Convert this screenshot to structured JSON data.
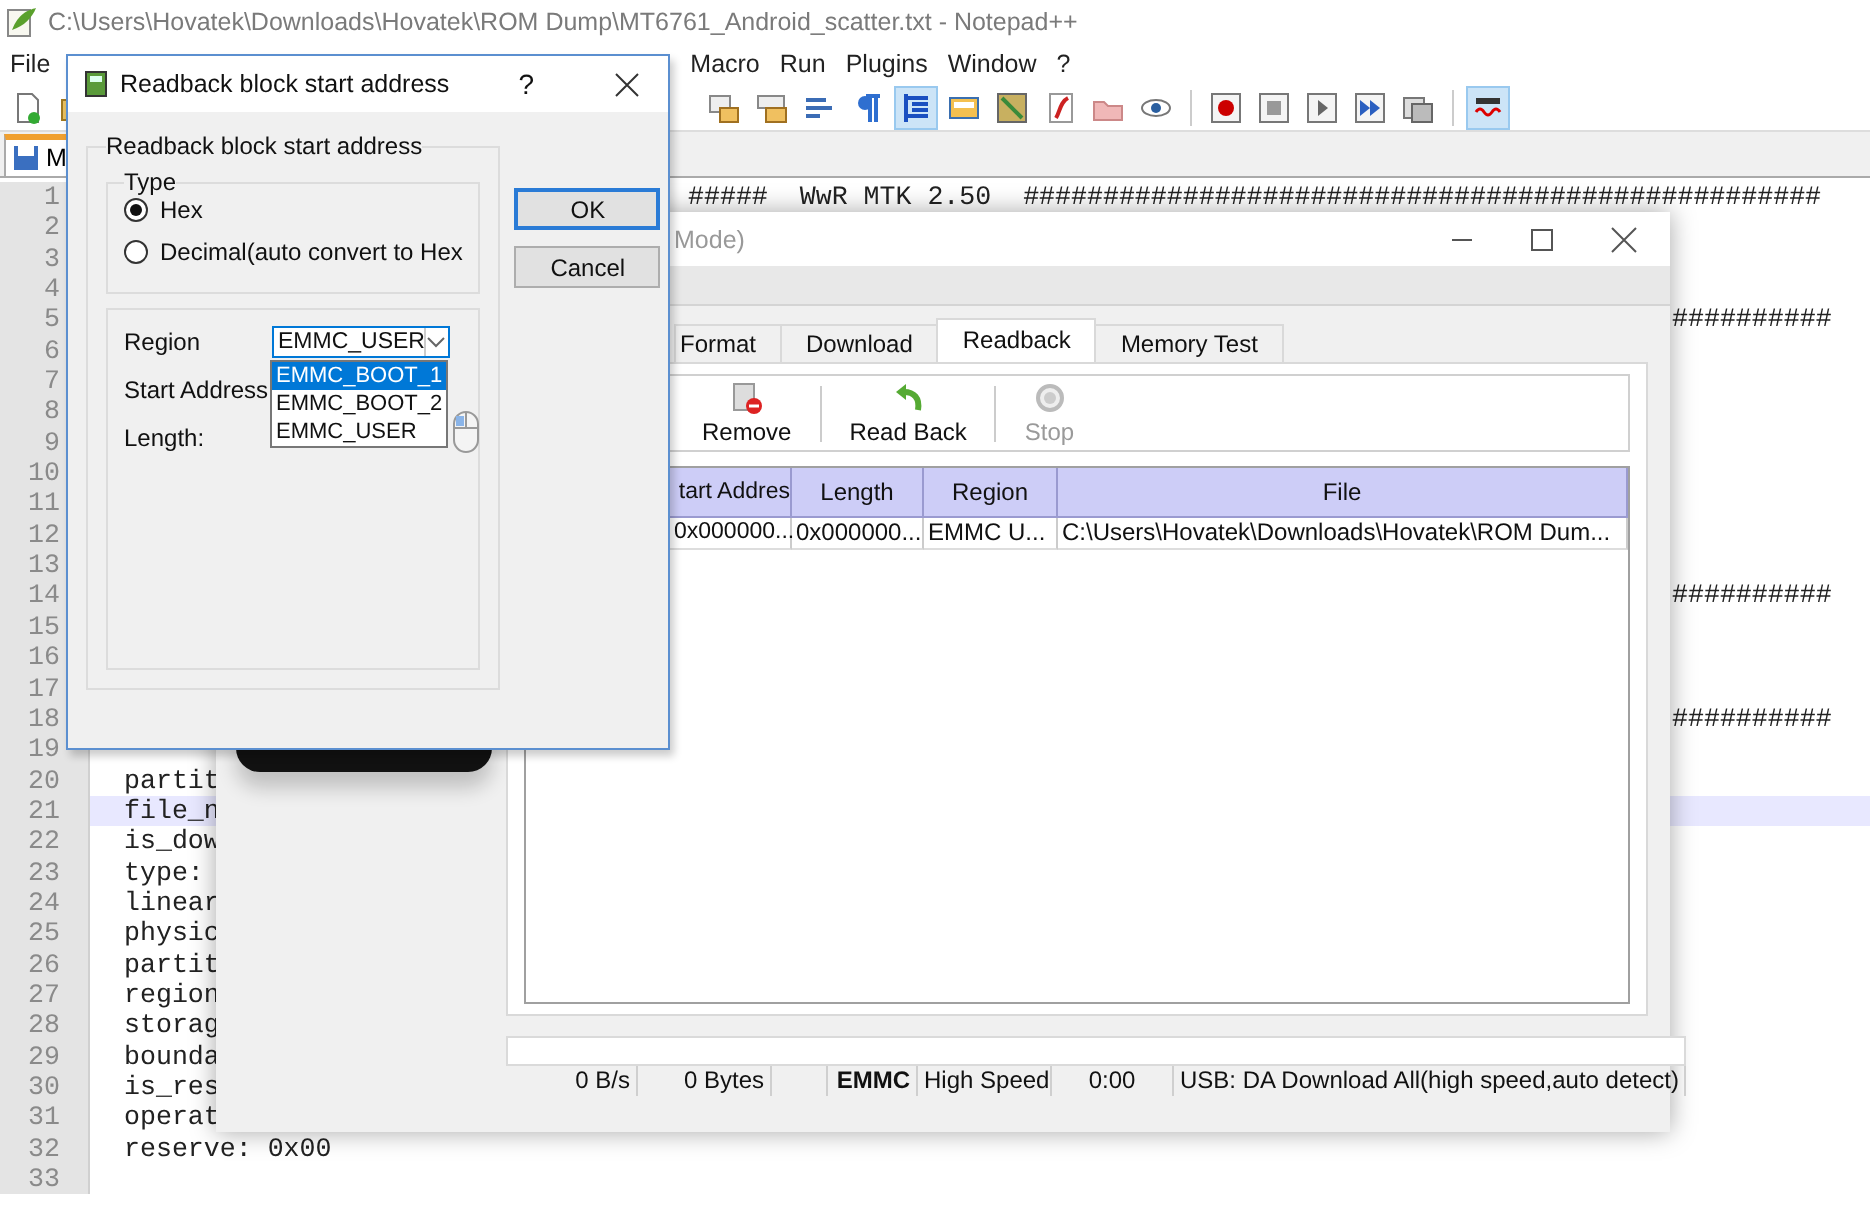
{
  "notepad": {
    "title": "C:\\Users\\Hovatek\\Downloads\\Hovatek\\ROM Dump\\MT6761_Android_scatter.txt - Notepad++",
    "menu": [
      {
        "label": "File"
      },
      {
        "label": "Macro"
      },
      {
        "label": "Run"
      },
      {
        "label": "Plugins"
      },
      {
        "label": "Window"
      },
      {
        "label": "?"
      }
    ],
    "toolbar": [
      {
        "kind": "new",
        "on": false
      },
      {
        "kind": "open",
        "on": false
      },
      {
        "kind": "sync-v",
        "on": false
      },
      {
        "kind": "sync-h",
        "on": false
      },
      {
        "kind": "wrap",
        "on": false
      },
      {
        "kind": "pilcrow",
        "on": false
      },
      {
        "kind": "indent",
        "on": true
      },
      {
        "kind": "panel",
        "on": false
      },
      {
        "kind": "map",
        "on": false
      },
      {
        "kind": "function",
        "on": false
      },
      {
        "kind": "folder",
        "on": false
      },
      {
        "kind": "eye",
        "on": false
      },
      {
        "kind": "record",
        "on": false
      },
      {
        "kind": "stop",
        "on": false
      },
      {
        "kind": "play",
        "on": false
      },
      {
        "kind": "run",
        "on": false
      },
      {
        "kind": "save",
        "on": false
      },
      {
        "kind": "spell",
        "on": true
      }
    ],
    "tab": {
      "label": "M"
    },
    "lines": [
      {
        "number": "1",
        "segments": [
          {
            "kind": "middle",
            "text": "#####  WwR MTK 2.50  ##################################################"
          }
        ]
      },
      {
        "number": "2"
      },
      {
        "number": "3"
      },
      {
        "number": "4"
      },
      {
        "number": "5",
        "segments": [
          {
            "kind": "end",
            "text": "##########"
          }
        ]
      },
      {
        "number": "6"
      },
      {
        "number": "7"
      },
      {
        "number": "8"
      },
      {
        "number": "9"
      },
      {
        "number": "10"
      },
      {
        "number": "11"
      },
      {
        "number": "12"
      },
      {
        "number": "13"
      },
      {
        "number": "14",
        "segments": [
          {
            "kind": "end",
            "text": "##########"
          }
        ]
      },
      {
        "number": "15"
      },
      {
        "number": "16"
      },
      {
        "number": "17"
      },
      {
        "number": "18",
        "segments": [
          {
            "kind": "end",
            "text": "##########"
          }
        ]
      },
      {
        "number": "19"
      },
      {
        "number": "20",
        "segments": [
          {
            "kind": "start",
            "text": "partit"
          }
        ]
      },
      {
        "number": "21",
        "highlighted": true,
        "segments": [
          {
            "kind": "start",
            "text": "file_n"
          }
        ]
      },
      {
        "number": "22",
        "segments": [
          {
            "kind": "start",
            "text": "is_dow"
          }
        ]
      },
      {
        "number": "23",
        "segments": [
          {
            "kind": "start",
            "text": "type:"
          }
        ]
      },
      {
        "number": "24",
        "segments": [
          {
            "kind": "start",
            "text": "linear"
          }
        ]
      },
      {
        "number": "25",
        "segments": [
          {
            "kind": "start",
            "text": "physic"
          }
        ]
      },
      {
        "number": "26",
        "segments": [
          {
            "kind": "start",
            "text": "partit"
          }
        ]
      },
      {
        "number": "27",
        "segments": [
          {
            "kind": "start",
            "text": "region"
          }
        ]
      },
      {
        "number": "28",
        "segments": [
          {
            "kind": "start",
            "text": "storag"
          }
        ]
      },
      {
        "number": "29",
        "segments": [
          {
            "kind": "start",
            "text": "bounda"
          }
        ]
      },
      {
        "number": "30",
        "segments": [
          {
            "kind": "start",
            "text": "is_res"
          }
        ]
      },
      {
        "number": "31",
        "segments": [
          {
            "kind": "start",
            "text": "operat"
          }
        ]
      },
      {
        "number": "32",
        "segments": [
          {
            "kind": "start",
            "text": "reserve: 0x00"
          }
        ]
      },
      {
        "number": "33"
      }
    ]
  },
  "flash_tool": {
    "title": "Mode)",
    "tabs": [
      {
        "label": "Format",
        "selected": false
      },
      {
        "label": "Download",
        "selected": false
      },
      {
        "label": "Readback",
        "selected": true
      },
      {
        "label": "Memory Test",
        "selected": false
      }
    ],
    "toolbar": [
      {
        "kind": "remove",
        "label": "Remove",
        "disabled": false
      },
      {
        "kind": "readback",
        "label": "Read Back",
        "disabled": false
      },
      {
        "kind": "stop",
        "label": "Stop",
        "disabled": true
      }
    ],
    "table": {
      "columns": [
        "tart Addres",
        "Length",
        "Region",
        "File"
      ],
      "rows": [
        [
          "0x000000...",
          "0x000000...",
          "EMMC U...",
          "C:\\Users\\Hovatek\\Downloads\\Hovatek\\ROM Dum..."
        ]
      ]
    },
    "progress": {
      "level": 0
    },
    "status_bar": [
      {
        "text": "0 B/s",
        "bold": false
      },
      {
        "text": "0 Bytes",
        "bold": false
      },
      {
        "text": "EMMC",
        "bold": true
      },
      {
        "text": "High Speed",
        "bold": false
      },
      {
        "text": "0:00",
        "bold": false
      },
      {
        "text": "USB: DA Download All(high speed,auto detect)",
        "bold": false
      }
    ]
  },
  "dialog": {
    "title": "Readback block start address",
    "help": "?",
    "group_label": "Readback block start address",
    "type_label": "Type",
    "radios": [
      {
        "label": "Hex",
        "selected": true
      },
      {
        "label": "Decimal(auto convert to Hex",
        "selected": false
      }
    ],
    "fields": [
      {
        "label": "Region"
      },
      {
        "label": "Start Address"
      },
      {
        "label": "Length:"
      }
    ],
    "combo": {
      "value": "EMMC_USER",
      "expanded": true,
      "options": [
        {
          "label": "EMMC_BOOT_1",
          "highlighted": true
        },
        {
          "label": "EMMC_BOOT_2",
          "highlighted": false
        },
        {
          "label": "EMMC_USER",
          "highlighted": false
        }
      ]
    },
    "buttons": [
      {
        "label": "OK",
        "default": true
      },
      {
        "label": "Cancel",
        "default": false
      }
    ]
  }
}
